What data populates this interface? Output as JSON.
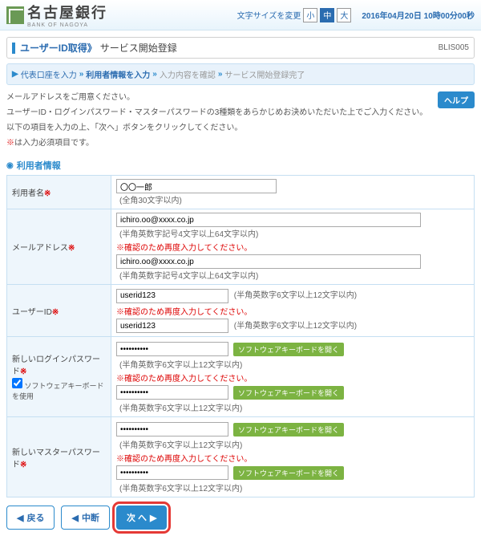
{
  "header": {
    "bank_name": "名古屋銀行",
    "bank_sub": "BANK OF NAGOYA",
    "font_label": "文字サイズを変更",
    "font_s": "小",
    "font_m": "中",
    "font_l": "大",
    "datetime": "2016年04月20日 10時00分00秒"
  },
  "title": {
    "main": "ユーザーID取得",
    "sep": "》",
    "sub": "サービス開始登録",
    "code": "BLIS005"
  },
  "steps": {
    "s1": "代表口座を入力",
    "s2": "利用者情報を入力",
    "s3": "入力内容を確認",
    "s4": "サービス開始登録完了"
  },
  "instructions": {
    "l1": "メールアドレスをご用意ください。",
    "l2": "ユーザーID・ログインパスワード・マスターパスワードの3種類をあらかじめお決めいただいた上でご入力ください。",
    "l3": "以下の項目を入力の上、「次へ」ボタンをクリックしてください。",
    "l4_pre": "※",
    "l4": "は入力必須項目です。"
  },
  "help": "ヘルプ",
  "section": "利用者情報",
  "fields": {
    "username": {
      "label": "利用者名",
      "value": "〇〇一郎",
      "hint": "(全角30文字以内)"
    },
    "email": {
      "label": "メールアドレス",
      "v1": "ichiro.oo@xxxx.co.jp",
      "hint": "(半角英数字記号4文字以上64文字以内)",
      "err": "※確認のため再度入力してください。",
      "v2": "ichiro.oo@xxxx.co.jp"
    },
    "userid": {
      "label": "ユーザーID",
      "v1": "userid123",
      "hint": "(半角英数字6文字以上12文字以内)",
      "err": "※確認のため再度入力してください。",
      "v2": "userid123"
    },
    "loginpw": {
      "label": "新しいログインパスワード",
      "chk": "ソフトウェアキーボードを使用",
      "kb": "ソフトウェアキーボードを開く",
      "hint": "(半角英数字6文字以上12文字以内)",
      "err": "※確認のため再度入力してください。"
    },
    "masterpw": {
      "label": "新しいマスターパスワード",
      "kb": "ソフトウェアキーボードを開く",
      "hint": "(半角英数字6文字以上12文字以内)",
      "err": "※確認のため再度入力してください。"
    }
  },
  "buttons": {
    "back": "戻る",
    "cancel": "中断",
    "next": "次 へ"
  }
}
